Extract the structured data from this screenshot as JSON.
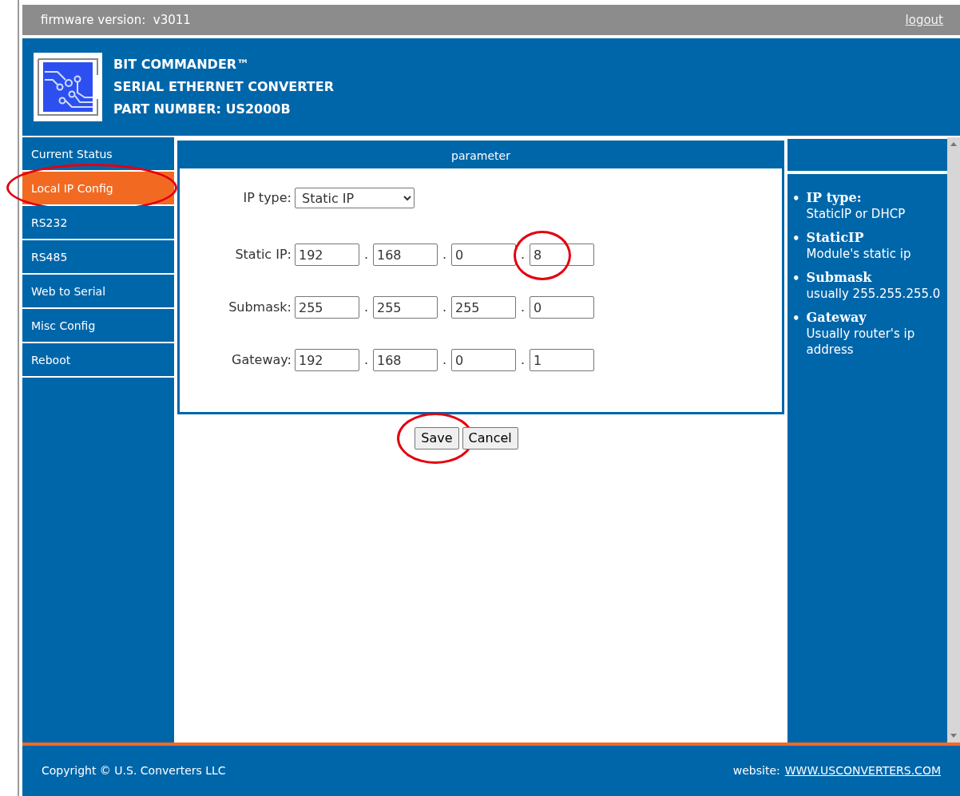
{
  "top_bar": {
    "firmware": "firmware version:  v3011",
    "logout": "logout"
  },
  "header": {
    "lines": [
      "BIT COMMANDER™",
      "SERIAL ETHERNET CONVERTER",
      "PART NUMBER: US2000B"
    ]
  },
  "sidebar": {
    "items": [
      {
        "label": "Current Status",
        "selected": false,
        "circled": false
      },
      {
        "label": "Local IP Config",
        "selected": true,
        "circled": true
      },
      {
        "label": "RS232",
        "selected": false,
        "circled": false
      },
      {
        "label": "RS485",
        "selected": false,
        "circled": false
      },
      {
        "label": "Web to Serial",
        "selected": false,
        "circled": false
      },
      {
        "label": "Misc Config",
        "selected": false,
        "circled": false
      },
      {
        "label": "Reboot",
        "selected": false,
        "circled": false
      }
    ]
  },
  "panel": {
    "title": "parameter",
    "ip_type": {
      "label": "IP type:",
      "value": "Static IP"
    },
    "rows": [
      {
        "label": "Static IP:",
        "octets": [
          {
            "value": "192",
            "circled": false
          },
          {
            "value": "168",
            "circled": false
          },
          {
            "value": "0",
            "circled": false
          },
          {
            "value": "8",
            "circled": true
          }
        ],
        "separators": [
          ".",
          ".",
          "."
        ]
      },
      {
        "label": "Submask:",
        "octets": [
          {
            "value": "255",
            "circled": false
          },
          {
            "value": "255",
            "circled": false
          },
          {
            "value": "255",
            "circled": false
          },
          {
            "value": "0",
            "circled": false
          }
        ],
        "separators": [
          ".",
          ".",
          "."
        ]
      },
      {
        "label": "Gateway:",
        "octets": [
          {
            "value": "192",
            "circled": false
          },
          {
            "value": "168",
            "circled": false
          },
          {
            "value": "0",
            "circled": false
          },
          {
            "value": "1",
            "circled": false
          }
        ],
        "separators": [
          ".",
          ".",
          "."
        ]
      }
    ],
    "buttons": [
      {
        "label": "Save",
        "circled": true
      },
      {
        "label": "Cancel",
        "circled": false
      }
    ]
  },
  "help": {
    "items": [
      {
        "term": "IP type:",
        "text": "StaticIP or DHCP"
      },
      {
        "term": "StaticIP",
        "text": "Module's static ip"
      },
      {
        "term": "Submask",
        "text": "usually 255.255.255.0"
      },
      {
        "term": "Gateway",
        "text": "Usually router's ip address"
      }
    ],
    "bullet": "•"
  },
  "footer": {
    "copyright": "Copyright © U.S. Converters LLC",
    "website_label": "website:",
    "website_link": "WWW.USCONVERTERS.COM"
  }
}
